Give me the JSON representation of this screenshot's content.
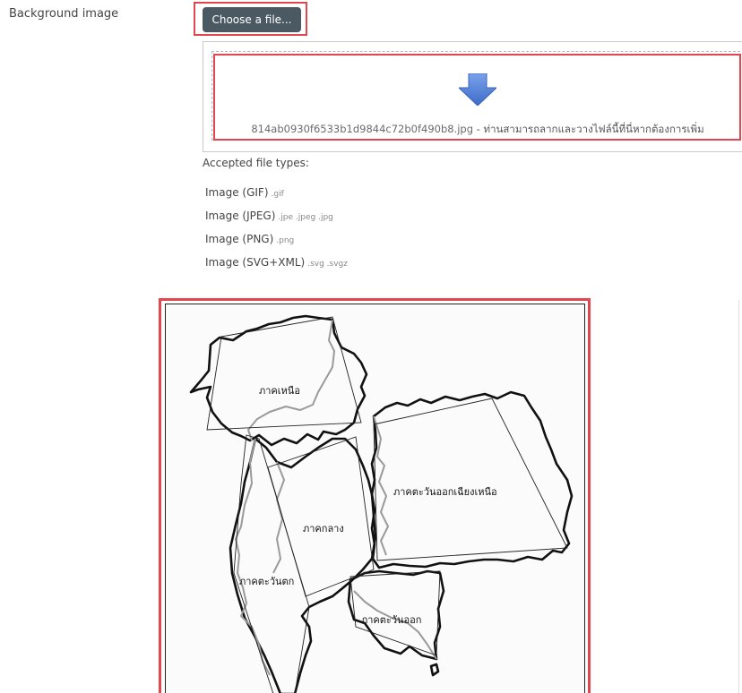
{
  "form": {
    "field_label": "Background image",
    "choose_button_label": "Choose a file...",
    "dropzone": {
      "filename": "814ab0930f6533b1d9844c72b0f490b8.jpg",
      "separator": " - ",
      "hint": "ท่านสามารถลากและวางไฟล์นี้ที่นี่หากต้องการเพิ่ม",
      "arrow_icon": "download-arrow-icon"
    },
    "accepted_title": "Accepted file types:",
    "file_types": [
      {
        "name": "Image (GIF)",
        "ext": ".gif"
      },
      {
        "name": "Image (JPEG)",
        "ext": ".jpe .jpeg .jpg"
      },
      {
        "name": "Image (PNG)",
        "ext": ".png"
      },
      {
        "name": "Image (SVG+XML)",
        "ext": ".svg .svgz"
      }
    ]
  },
  "map": {
    "regions": {
      "north": "ภาคเหนือ",
      "northeast": "ภาคตะวันออกเฉียงเหนือ",
      "central": "ภาคกลาง",
      "west": "ภาคตะวันตก",
      "east": "ภาคตะวันออก"
    }
  },
  "colors": {
    "highlight": "#e2474f",
    "button_bg": "#4b5963",
    "arrow": "#4f7fd6"
  }
}
